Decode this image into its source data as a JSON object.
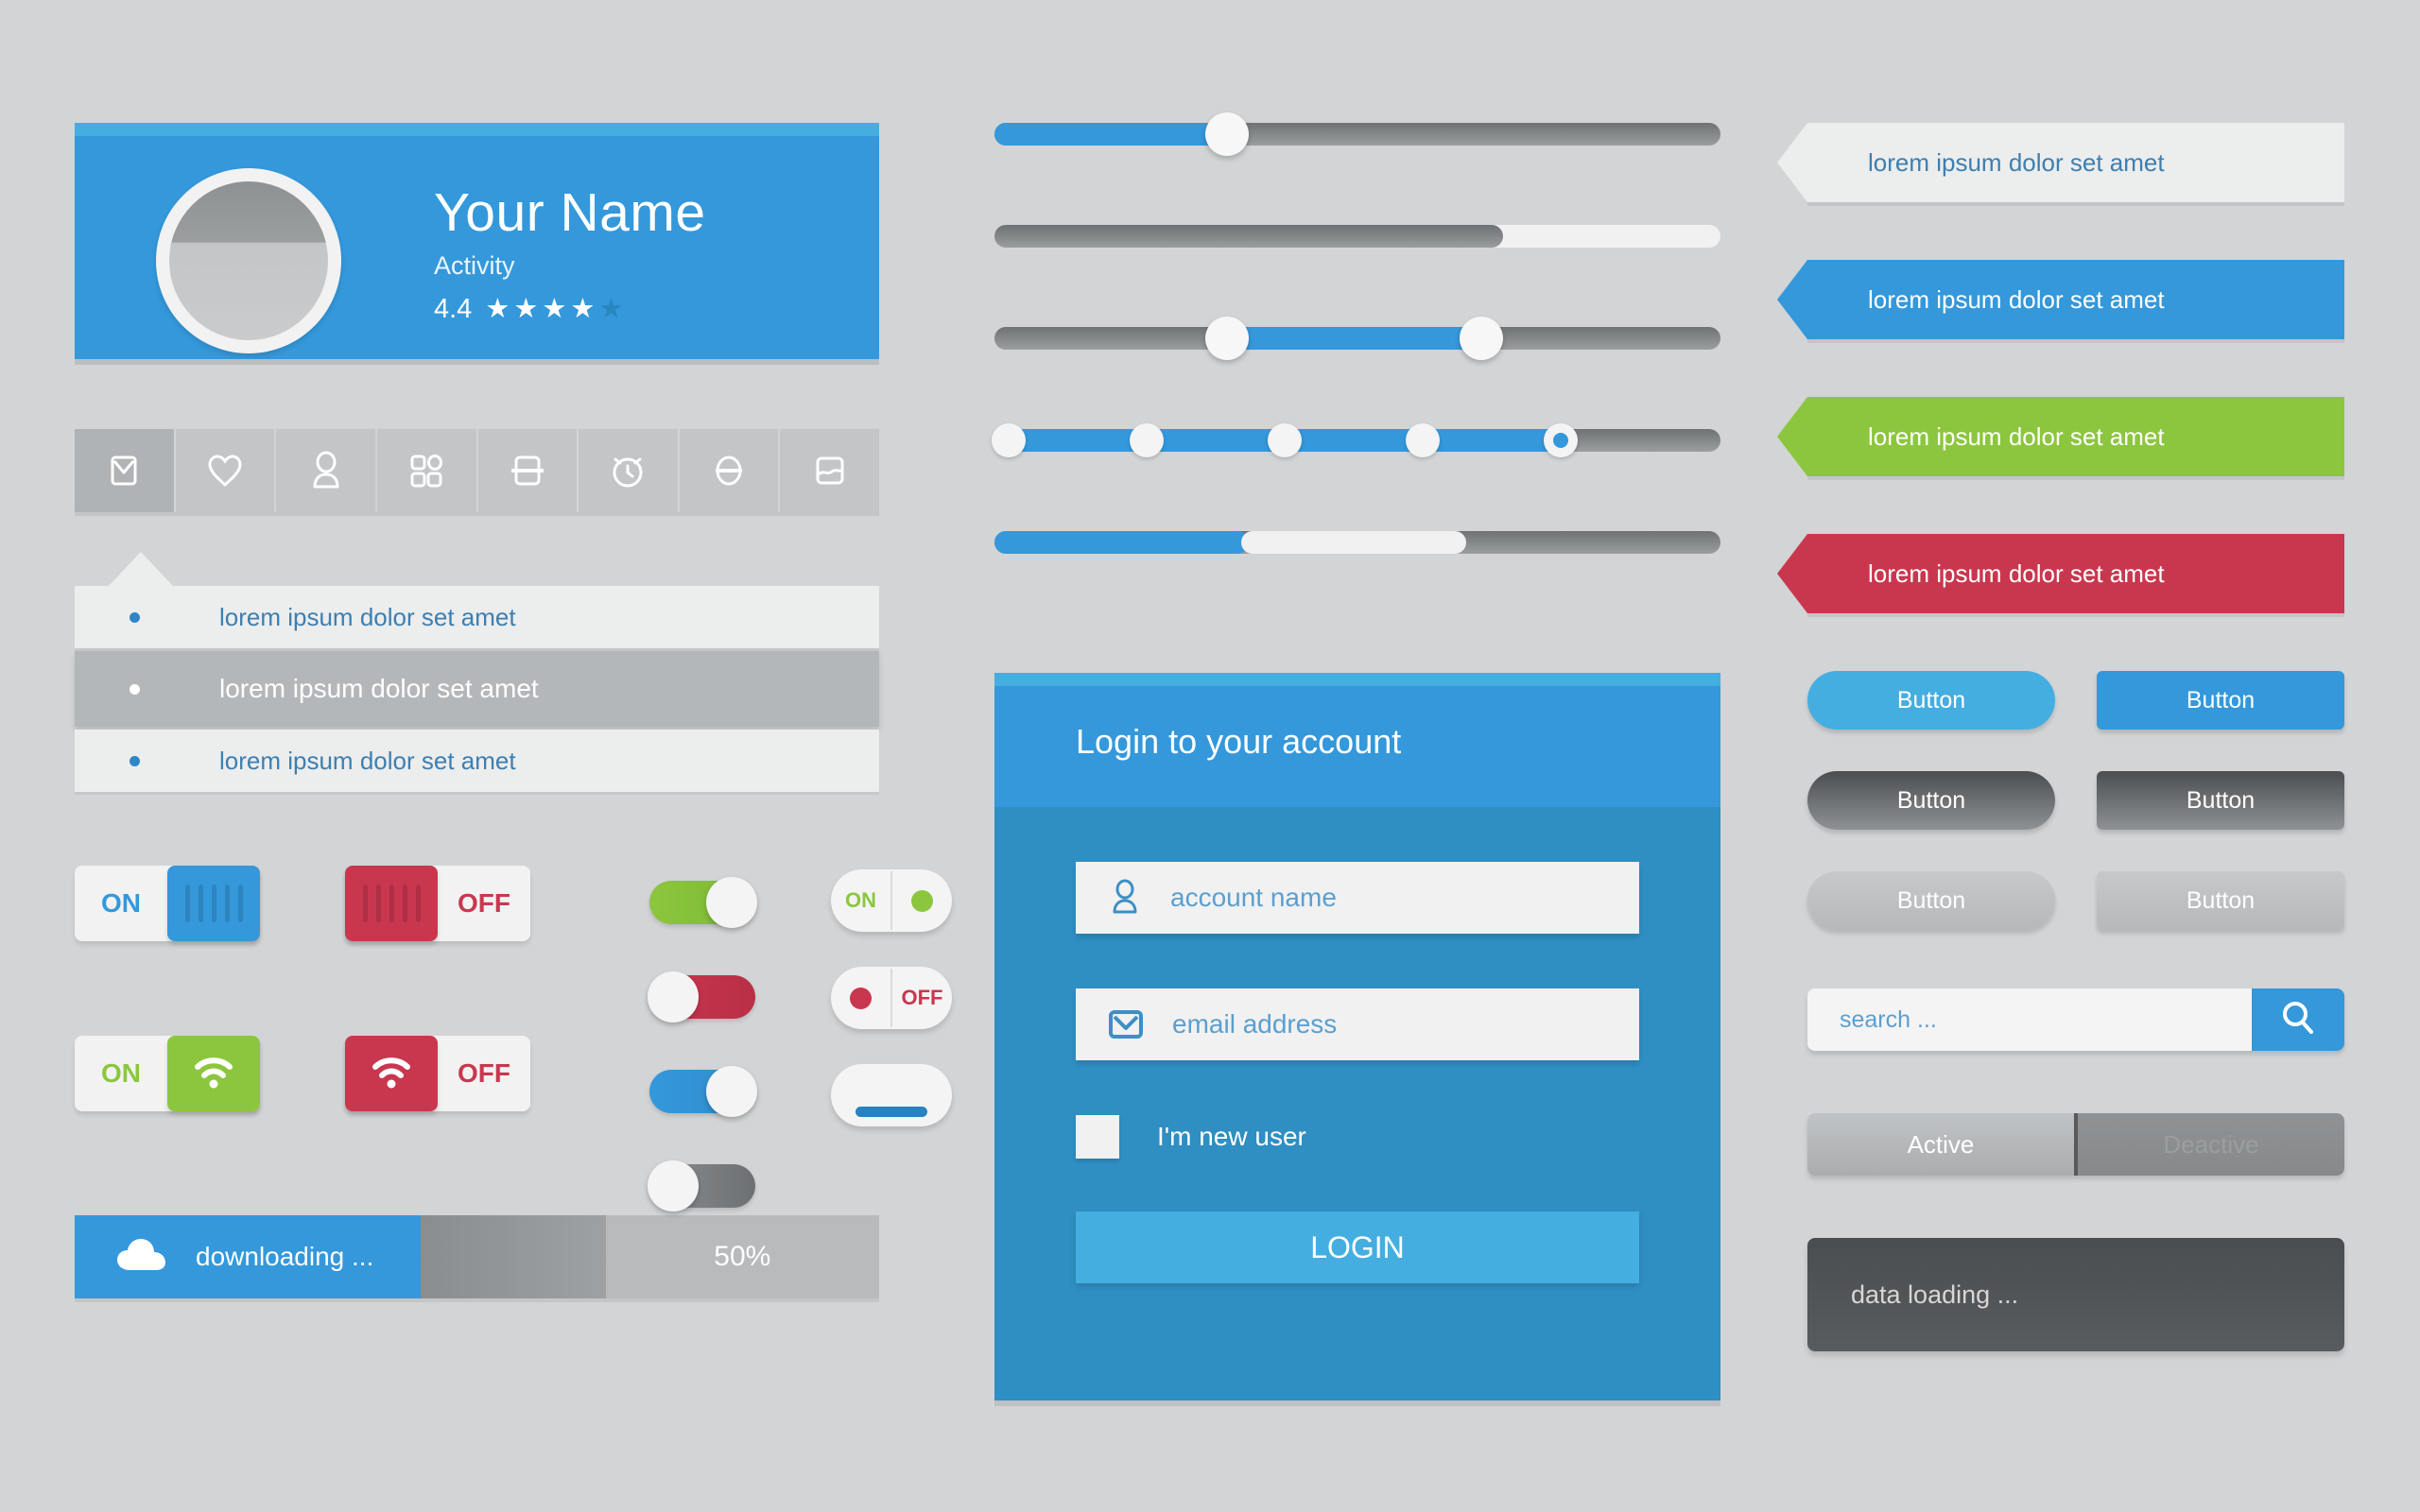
{
  "profile": {
    "name": "Your Name",
    "activity_label": "Activity",
    "rating_value": "4.4",
    "stars_filled": 4,
    "stars_total": 5,
    "avatar_icon": "avatar-placeholder"
  },
  "icon_bar": {
    "items": [
      {
        "icon": "mail-icon",
        "active": true
      },
      {
        "icon": "heart-icon",
        "active": false
      },
      {
        "icon": "user-icon",
        "active": false
      },
      {
        "icon": "grid-icon",
        "active": false
      },
      {
        "icon": "archive-box-icon",
        "active": false
      },
      {
        "icon": "alarm-clock-icon",
        "active": false
      },
      {
        "icon": "lock-icon",
        "active": false
      },
      {
        "icon": "image-icon",
        "active": false
      }
    ]
  },
  "list": {
    "items": [
      {
        "label": "lorem ipsum dolor set amet",
        "selected": false
      },
      {
        "label": "lorem ipsum dolor set amet",
        "selected": true
      },
      {
        "label": "lorem ipsum dolor set amet",
        "selected": false
      }
    ]
  },
  "square_toggles": [
    {
      "label": "ON",
      "state": "on",
      "color": "#3498db",
      "icon": "grip-icon",
      "knob_side": "right"
    },
    {
      "label": "OFF",
      "state": "off",
      "color": "#c9374f",
      "icon": "grip-icon",
      "knob_side": "left"
    },
    {
      "label": "ON",
      "state": "on",
      "color": "#8cc63e",
      "icon": "wifi-icon",
      "knob_side": "right"
    },
    {
      "label": "OFF",
      "state": "off",
      "color": "#c9374f",
      "icon": "wifi-icon",
      "knob_side": "left"
    }
  ],
  "pill_toggles": [
    {
      "color": "#8cc63e",
      "state": "on"
    },
    {
      "color": "#c9374f",
      "state": "off"
    },
    {
      "color": "#3498db",
      "state": "on"
    },
    {
      "color": "#8c8f91",
      "state": "off"
    }
  ],
  "segmented_pills": [
    {
      "label": "ON",
      "dot_color": "#8cc63e",
      "label_side": "left"
    },
    {
      "label": "OFF",
      "dot_color": "#c9374f",
      "label_side": "right"
    },
    {
      "label": "",
      "bar_color": "#2782be"
    }
  ],
  "download": {
    "label": "downloading ...",
    "percent_label": "50%",
    "percent": 50,
    "icon": "cloud-icon",
    "fill_color": "#3498db"
  },
  "sliders": [
    {
      "name": "single-blue",
      "type": "single",
      "value": 32,
      "fill": "blue"
    },
    {
      "name": "dark-progress",
      "type": "single-nohandle",
      "value": 70,
      "fill": "dark"
    },
    {
      "name": "range-blue",
      "type": "range",
      "low": 32,
      "high": 67,
      "fill": "blue"
    },
    {
      "name": "stepped-blue",
      "type": "stepped",
      "value": 4,
      "steps": 5,
      "step_positions": [
        1.5,
        19,
        38,
        57,
        77
      ],
      "fill": "blue"
    },
    {
      "name": "segmented-blue",
      "type": "segmented",
      "value": 35,
      "segment_end": 65,
      "fill": "blue"
    }
  ],
  "login": {
    "title": "Login to your account",
    "account_field": {
      "placeholder": "account name",
      "value": "",
      "icon": "user-icon"
    },
    "email_field": {
      "placeholder": "email address",
      "value": "",
      "icon": "mail-icon"
    },
    "new_user_label": "I'm new user",
    "new_user_checked": false,
    "submit_label": "LOGIN",
    "accent": "#3498db"
  },
  "ribbons": [
    {
      "text": "lorem ipsum dolor set amet",
      "style": "white",
      "color": "#eceded"
    },
    {
      "text": "lorem ipsum dolor set amet",
      "style": "blue",
      "color": "#3498db"
    },
    {
      "text": "lorem ipsum dolor set amet",
      "style": "green",
      "color": "#8cc63e"
    },
    {
      "text": "lorem ipsum dolor set amet",
      "style": "red",
      "color": "#c9374f"
    }
  ],
  "buttons": [
    {
      "label": "Button",
      "shape": "pill",
      "variant": "blue"
    },
    {
      "label": "Button",
      "shape": "rect",
      "variant": "blue2"
    },
    {
      "label": "Button",
      "shape": "pill",
      "variant": "dark"
    },
    {
      "label": "Button",
      "shape": "rect",
      "variant": "dark"
    },
    {
      "label": "Button",
      "shape": "pill",
      "variant": "light"
    },
    {
      "label": "Button",
      "shape": "rect",
      "variant": "light"
    }
  ],
  "search": {
    "placeholder": "search ...",
    "value": "",
    "button_icon": "search-icon",
    "button_color": "#3498db"
  },
  "active_toggle": {
    "active_label": "Active",
    "inactive_label": "Deactive",
    "selected": "Active"
  },
  "loading": {
    "label": "data loading ..."
  }
}
